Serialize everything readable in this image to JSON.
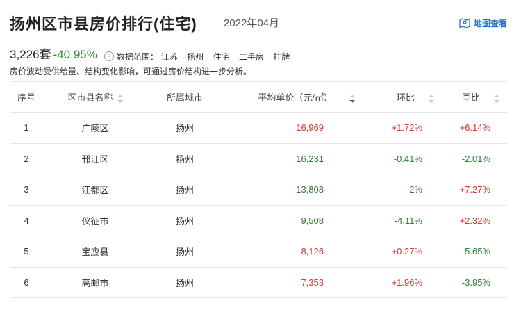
{
  "header": {
    "title": "扬州区市县房价排行(住宅)",
    "date": "2022年04月",
    "map_link": "地图查看"
  },
  "summary": {
    "count": "3,226套",
    "change": "-40.95%",
    "scope_label": "数据范围：",
    "scope_items": [
      "江苏",
      "扬州",
      "住宅",
      "二手房",
      "挂牌"
    ],
    "help_icon": "?"
  },
  "note": "房价波动受供给量、结构变化影响，可通过房价结构进一步分析。",
  "table": {
    "columns": [
      "序号",
      "区市县名称",
      "所属城市",
      "平均单价（元/㎡）",
      "环比",
      "同比"
    ],
    "rows": [
      {
        "rank": "1",
        "district": "广陵区",
        "city": "扬州",
        "price": "16,969",
        "mom": "+1.72%",
        "yoy": "+6.14%"
      },
      {
        "rank": "2",
        "district": "邗江区",
        "city": "扬州",
        "price": "16,231",
        "mom": "-0.41%",
        "yoy": "-2.01%"
      },
      {
        "rank": "3",
        "district": "江都区",
        "city": "扬州",
        "price": "13,808",
        "mom": "-2%",
        "yoy": "+7.27%"
      },
      {
        "rank": "4",
        "district": "仪征市",
        "city": "扬州",
        "price": "9,508",
        "mom": "-4.11%",
        "yoy": "+2.32%"
      },
      {
        "rank": "5",
        "district": "宝应县",
        "city": "扬州",
        "price": "8,126",
        "mom": "+0.27%",
        "yoy": "-5.65%"
      },
      {
        "rank": "6",
        "district": "高邮市",
        "city": "扬州",
        "price": "7,353",
        "mom": "+1.96%",
        "yoy": "-3.95%"
      }
    ]
  },
  "colors": {
    "up": "#d03a2c",
    "down": "#2e7d32",
    "link": "#2a6fc9"
  },
  "icons": {
    "map": "map-pin-icon",
    "help": "question-icon",
    "sort": "sort-icon"
  }
}
